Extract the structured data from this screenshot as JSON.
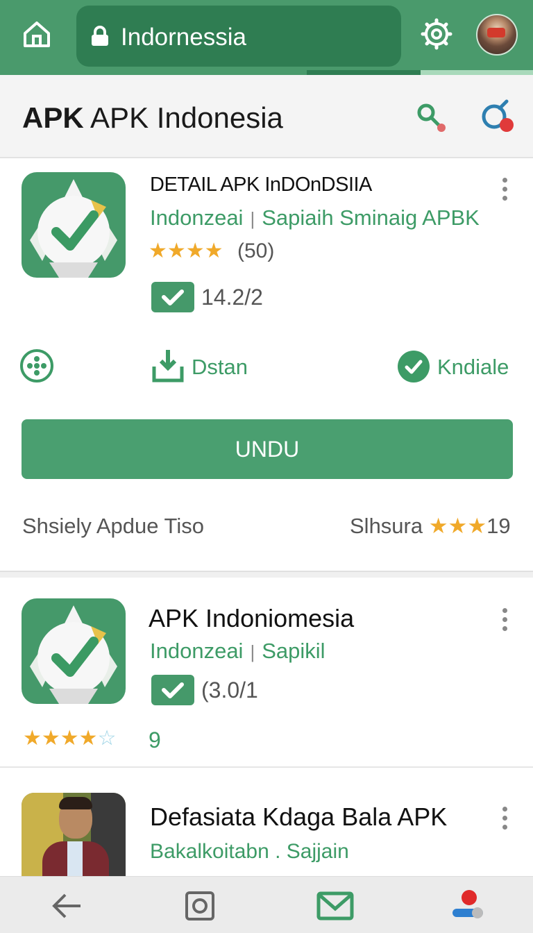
{
  "browser": {
    "url_text": "Indornessia",
    "colors": {
      "bar": "#4a9a6c",
      "url_bg": "#2f7d52",
      "accent": "#45996a"
    }
  },
  "header": {
    "title_bold": "APK",
    "title_rest": " APK Indonesia"
  },
  "card1": {
    "title": "DETAIL APK InDOnDSIIA",
    "developer": "Indonzeai",
    "separator": "|",
    "category": "Sapiaih Sminaig APBK",
    "rating_stars": 3.5,
    "stars_display": "★★★★",
    "rating_count": "(50)",
    "version": "14.2/2",
    "action_download_label": "Dstan",
    "action_verified_label": "Kndiale",
    "primary_button": "UNDU",
    "footer_left": "Shsiely Apdue Tiso",
    "footer_right_label": "Slhsura",
    "footer_right_stars": "★★★",
    "footer_right_count": "19"
  },
  "card2": {
    "title": "APK Indoniomesia",
    "developer": "Indonzeai",
    "separator": "|",
    "category": "Sapikil",
    "version": "(3.0/1",
    "rating_stars": 3.5,
    "stars_full": "★★★★",
    "stars_empty": "☆",
    "rating_count": "9"
  },
  "card3": {
    "title": "Defasiata Kdaga Bala APK",
    "subtitle": "Bakalkoitabn . Sajjain"
  },
  "icons": {
    "home": "home-icon",
    "lock": "lock-icon",
    "settings": "gear-icon",
    "search": "search-icon",
    "notification": "notification-icon",
    "more": "more-vert-icon",
    "grid": "dots-circle-icon",
    "download": "download-icon",
    "verified": "check-circle-icon",
    "back": "back-arrow-icon",
    "recents": "square-icon",
    "mail": "mail-icon",
    "profile": "profile-toggle-icon"
  }
}
